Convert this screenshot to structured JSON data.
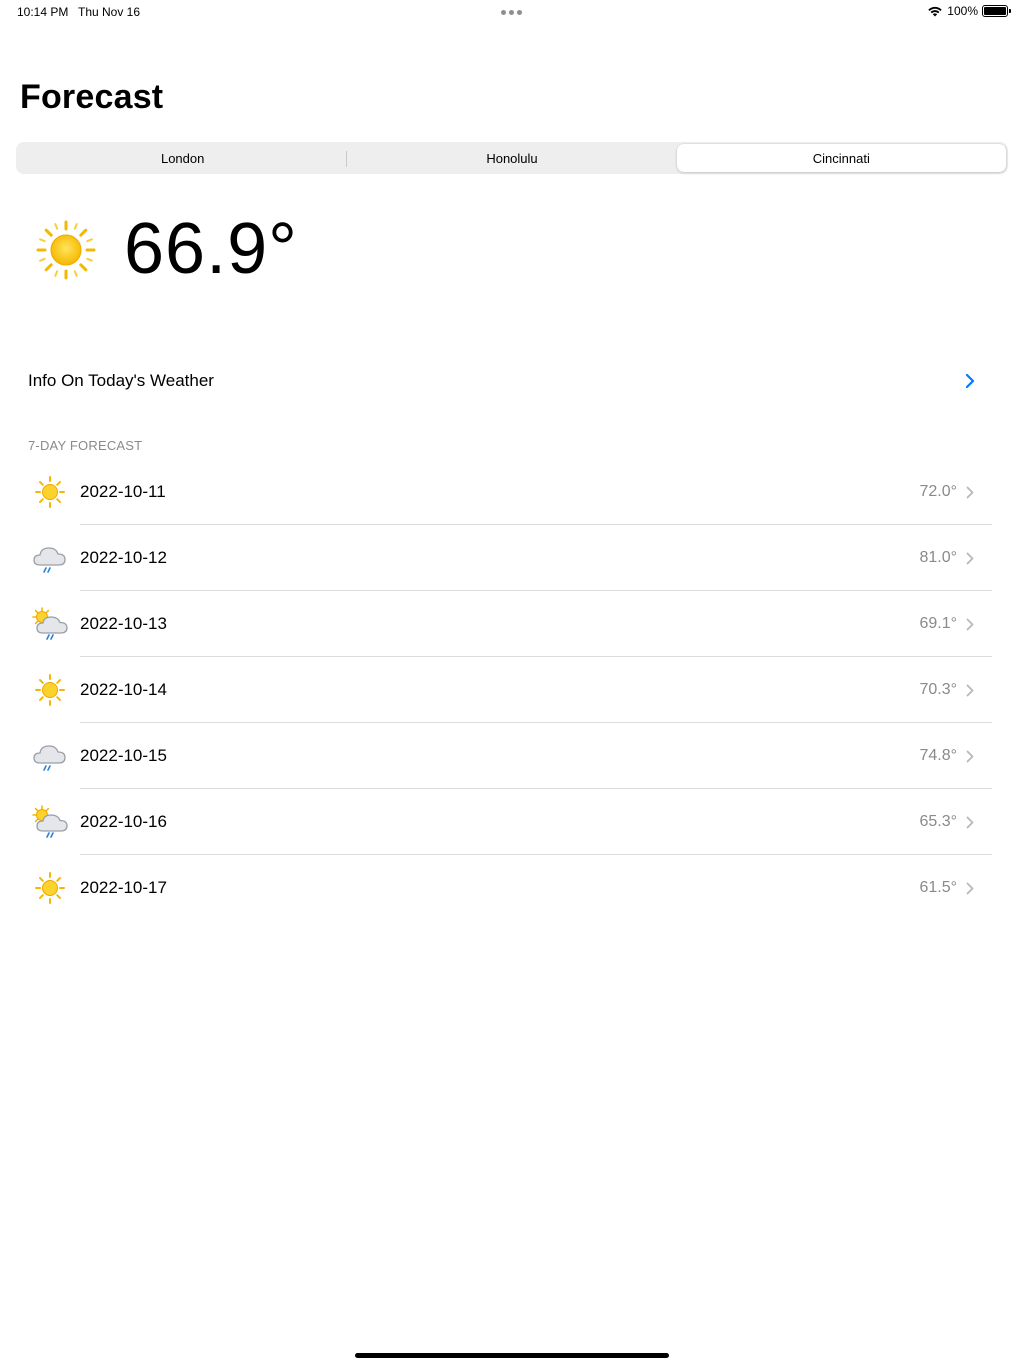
{
  "status_bar": {
    "time": "10:14 PM",
    "date": "Thu Nov 16",
    "battery": "100%"
  },
  "header": {
    "title": "Forecast"
  },
  "segmented_control": {
    "segments": [
      {
        "label": "London",
        "selected": false
      },
      {
        "label": "Honolulu",
        "selected": false
      },
      {
        "label": "Cincinnati",
        "selected": true
      }
    ]
  },
  "current": {
    "icon": "sun-icon",
    "temperature": "66.9°"
  },
  "info": {
    "label": "Info On Today's Weather",
    "chevron_color": "#007aff"
  },
  "forecast": {
    "header": "7-DAY FORECAST",
    "days": [
      {
        "date": "2022-10-11",
        "temp": "72.0°",
        "icon": "sun-icon"
      },
      {
        "date": "2022-10-12",
        "temp": "81.0°",
        "icon": "cloud-rain-icon"
      },
      {
        "date": "2022-10-13",
        "temp": "69.1°",
        "icon": "sun-cloud-rain-icon"
      },
      {
        "date": "2022-10-14",
        "temp": "70.3°",
        "icon": "sun-icon"
      },
      {
        "date": "2022-10-15",
        "temp": "74.8°",
        "icon": "cloud-rain-icon"
      },
      {
        "date": "2022-10-16",
        "temp": "65.3°",
        "icon": "sun-cloud-rain-icon"
      },
      {
        "date": "2022-10-17",
        "temp": "61.5°",
        "icon": "sun-icon"
      }
    ]
  },
  "colors": {
    "accent": "#007aff",
    "sun": "#f7c600",
    "secondary_text": "#8a8a8e"
  }
}
